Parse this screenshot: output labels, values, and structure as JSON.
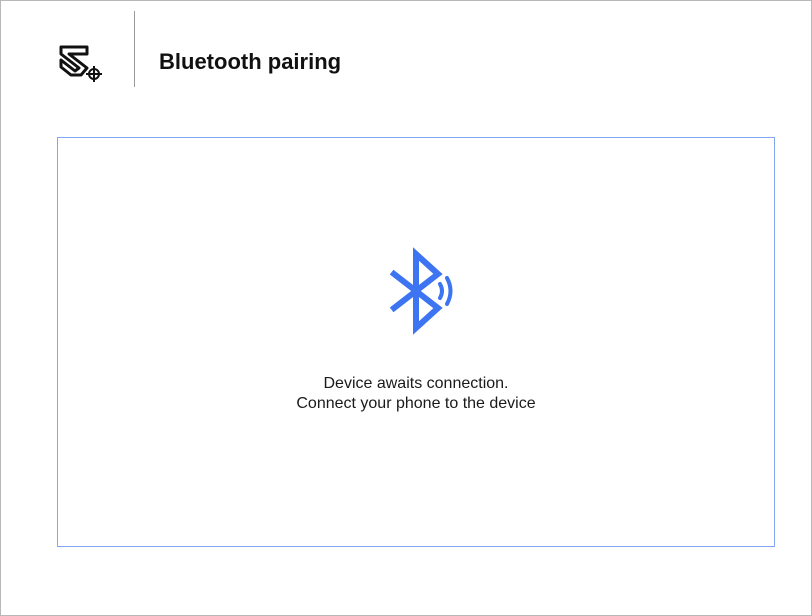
{
  "header": {
    "title": "Bluetooth pairing",
    "logo_icon": "brand-logo-icon"
  },
  "panel": {
    "icon": "bluetooth-icon",
    "message_line1": "Device awaits connection.",
    "message_line2": "Connect your phone to the device"
  },
  "colors": {
    "accent": "#3d74f1",
    "panel_border": "#7fa7f2",
    "text": "#1a1a1a"
  }
}
